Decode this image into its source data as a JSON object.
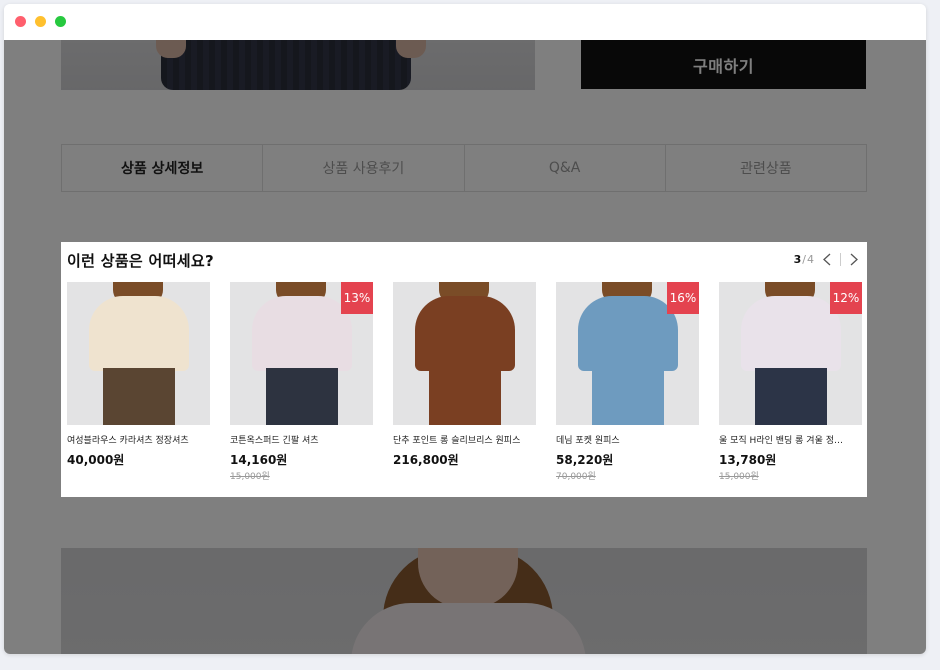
{
  "window_controls": [
    "close",
    "minimize",
    "maximize"
  ],
  "buy_button": {
    "label": "구매하기"
  },
  "tabs": [
    {
      "label": "상품 상세정보",
      "active": true
    },
    {
      "label": "상품 사용후기",
      "active": false
    },
    {
      "label": "Q&A",
      "active": false
    },
    {
      "label": "관련상품",
      "active": false
    }
  ],
  "recommend": {
    "title": "이런 상품은 어떠세요?",
    "pager": {
      "current": "3",
      "separator": "/",
      "total": "4"
    },
    "products": [
      {
        "name": "여성블라우스 카라셔츠 정장셔츠",
        "price": "40,000원",
        "original_price": "",
        "discount": "",
        "top_color": "#efe3cf",
        "bottom_color": "#5a4532"
      },
      {
        "name": "코튼옥스퍼드 긴팔 셔츠",
        "price": "14,160원",
        "original_price": "15,000원",
        "discount": "13%",
        "top_color": "#e8dde3",
        "bottom_color": "#2d3340"
      },
      {
        "name": "단추 포인트 롱 슬리브리스 원피스",
        "price": "216,800원",
        "original_price": "",
        "discount": "",
        "top_color": "#7a3f22",
        "bottom_color": "#7a3f22"
      },
      {
        "name": "데님 포켓 원피스",
        "price": "58,220원",
        "original_price": "70,000원",
        "discount": "16%",
        "top_color": "#6e9bbf",
        "bottom_color": "#6e9bbf"
      },
      {
        "name": "울 모직 H라인 밴딩 롱 겨울 정…",
        "price": "13,780원",
        "original_price": "15,000원",
        "discount": "12%",
        "top_color": "#e9e2ea",
        "bottom_color": "#2c3447"
      }
    ]
  }
}
